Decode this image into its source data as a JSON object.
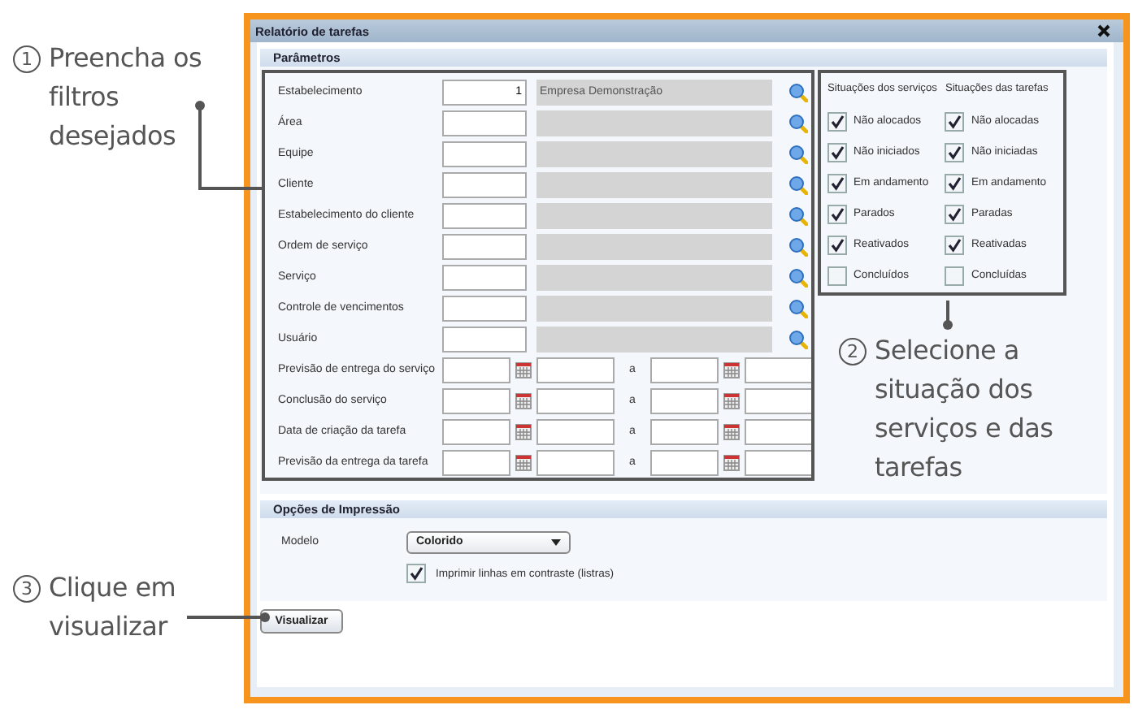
{
  "annotations": [
    {
      "number": "1",
      "lines": [
        "Preencha os",
        "filtros",
        "desejados"
      ]
    },
    {
      "number": "2",
      "lines": [
        "Selecione a",
        "situação dos",
        "serviços e das",
        "tarefas"
      ]
    },
    {
      "number": "3",
      "lines": [
        "Clique em",
        "visualizar"
      ]
    }
  ],
  "dialog": {
    "title": "Relatório de tarefas",
    "parameters": {
      "heading": "Parâmetros",
      "fields": [
        {
          "kind": "lookup",
          "label": "Estabelecimento",
          "code": "1",
          "description": "Empresa Demonstração"
        },
        {
          "kind": "lookup",
          "label": "Área"
        },
        {
          "kind": "lookup",
          "label": "Equipe"
        },
        {
          "kind": "lookup",
          "label": "Cliente"
        },
        {
          "kind": "lookup",
          "label": "Estabelecimento do cliente"
        },
        {
          "kind": "lookup",
          "label": "Ordem de serviço"
        },
        {
          "kind": "lookup",
          "label": "Serviço"
        },
        {
          "kind": "lookup",
          "label": "Controle de vencimentos"
        },
        {
          "kind": "lookup",
          "label": "Usuário"
        },
        {
          "kind": "date_range",
          "label": "Previsão de entrega do serviço",
          "separator": "a"
        },
        {
          "kind": "date_range",
          "label": "Conclusão do serviço",
          "separator": "a"
        },
        {
          "kind": "date_range",
          "label": "Data de criação da tarefa",
          "separator": "a"
        },
        {
          "kind": "date_range",
          "label": "Previsão da entrega da tarefa",
          "separator": "a"
        }
      ],
      "status_groups": [
        {
          "heading": "Situações dos serviços",
          "options": [
            {
              "label": "Não alocados",
              "checked": true
            },
            {
              "label": "Não iniciados",
              "checked": true
            },
            {
              "label": "Em andamento",
              "checked": true
            },
            {
              "label": "Parados",
              "checked": true
            },
            {
              "label": "Reativados",
              "checked": true
            },
            {
              "label": "Concluídos",
              "checked": false
            }
          ]
        },
        {
          "heading": "Situações das tarefas",
          "options": [
            {
              "label": "Não alocadas",
              "checked": true
            },
            {
              "label": "Não iniciadas",
              "checked": true
            },
            {
              "label": "Em andamento",
              "checked": true
            },
            {
              "label": "Paradas",
              "checked": true
            },
            {
              "label": "Reativadas",
              "checked": true
            },
            {
              "label": "Concluídas",
              "checked": false
            }
          ]
        }
      ]
    },
    "print_options": {
      "heading": "Opções de Impressão",
      "model_label": "Modelo",
      "model_value": "Colorido",
      "stripes": {
        "label": "Imprimir linhas em contraste (listras)",
        "checked": true
      }
    },
    "preview_button": "Visualizar"
  }
}
